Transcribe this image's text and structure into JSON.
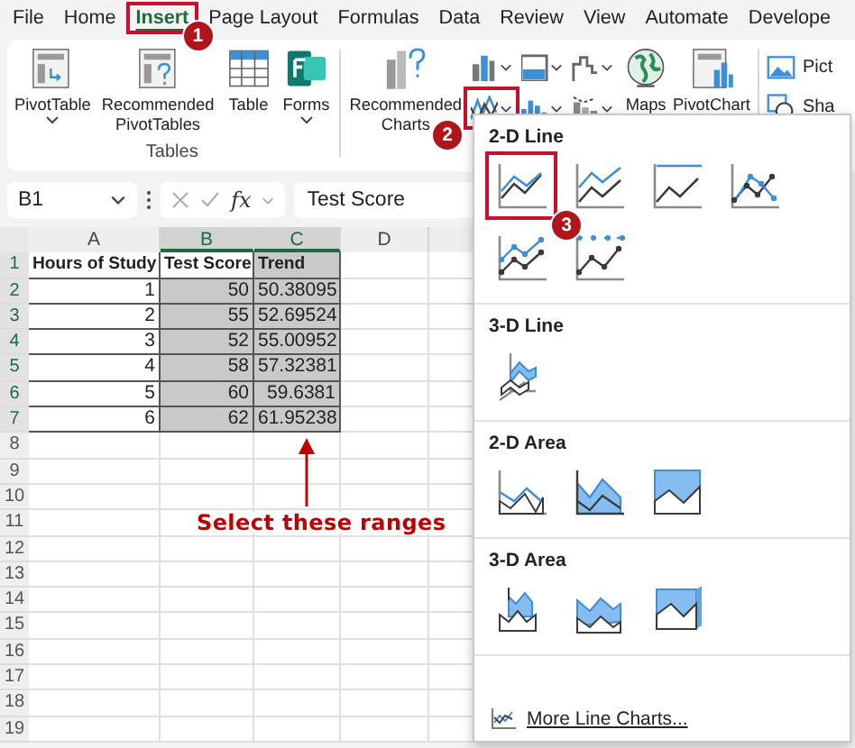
{
  "menu_tabs": [
    {
      "label": "File",
      "selected": false
    },
    {
      "label": "Home",
      "selected": false
    },
    {
      "label": "Insert",
      "selected": true,
      "callout": "1"
    },
    {
      "label": "Page Layout",
      "selected": false
    },
    {
      "label": "Formulas",
      "selected": false
    },
    {
      "label": "Data",
      "selected": false
    },
    {
      "label": "Review",
      "selected": false
    },
    {
      "label": "View",
      "selected": false
    },
    {
      "label": "Automate",
      "selected": false
    },
    {
      "label": "Develope",
      "selected": false
    }
  ],
  "tables_group": {
    "label": "Tables",
    "buttons": [
      {
        "kind": "pivot",
        "lines": [
          "PivotTable"
        ],
        "dropdown": true
      },
      {
        "kind": "recommended_pivot",
        "lines": [
          "Recommended",
          "PivotTables"
        ],
        "dropdown": false
      },
      {
        "kind": "table",
        "lines": [
          "Table"
        ],
        "dropdown": false
      },
      {
        "kind": "forms",
        "lines": [
          "Forms"
        ],
        "dropdown": true
      }
    ]
  },
  "charts_group": {
    "recommended": {
      "kind": "recommended_charts",
      "lines": [
        "Recommended",
        "Charts"
      ]
    },
    "chart_buttons": [
      {
        "kind": "column"
      },
      {
        "kind": "hierarchy"
      },
      {
        "kind": "waterfall"
      },
      {
        "kind": "line",
        "callout": "2"
      },
      {
        "kind": "statistic"
      },
      {
        "kind": "scatter"
      }
    ],
    "big_buttons": [
      {
        "kind": "maps",
        "label": "Maps"
      },
      {
        "kind": "pivot_chart",
        "label": "PivotChart"
      }
    ]
  },
  "illustrations_partial": [
    {
      "kind": "picture",
      "label": "Pict"
    },
    {
      "kind": "shapes",
      "label": "Sha"
    }
  ],
  "formula_bar": {
    "name_box": "B1",
    "function_label": "fx",
    "value": "Test Score"
  },
  "sheet": {
    "columns": [
      {
        "label": "A",
        "selected": false
      },
      {
        "label": "B",
        "selected": true
      },
      {
        "label": "C",
        "selected": true
      },
      {
        "label": "D",
        "selected": false
      }
    ],
    "rows": [
      {
        "number": "1",
        "cells": [
          {
            "text": "Hours of Study",
            "selected": false
          },
          {
            "text": "Test Score",
            "selected": false
          },
          {
            "text": "Trend",
            "selected": true
          }
        ]
      },
      {
        "number": "2",
        "cells": [
          {
            "text": "1",
            "selected": false
          },
          {
            "text": "50",
            "selected": true
          },
          {
            "text": "50.38095",
            "selected": true
          }
        ]
      },
      {
        "number": "3",
        "cells": [
          {
            "text": "2",
            "selected": false
          },
          {
            "text": "55",
            "selected": true
          },
          {
            "text": "52.69524",
            "selected": true
          }
        ]
      },
      {
        "number": "4",
        "cells": [
          {
            "text": "3",
            "selected": false
          },
          {
            "text": "52",
            "selected": true
          },
          {
            "text": "55.00952",
            "selected": true
          }
        ]
      },
      {
        "number": "5",
        "cells": [
          {
            "text": "4",
            "selected": false
          },
          {
            "text": "58",
            "selected": true
          },
          {
            "text": "57.32381",
            "selected": true
          }
        ]
      },
      {
        "number": "6",
        "cells": [
          {
            "text": "5",
            "selected": false
          },
          {
            "text": "60",
            "selected": true
          },
          {
            "text": "59.6381",
            "selected": true
          }
        ]
      },
      {
        "number": "7",
        "cells": [
          {
            "text": "6",
            "selected": false
          },
          {
            "text": "62",
            "selected": true
          },
          {
            "text": "61.95238",
            "selected": true
          }
        ]
      }
    ],
    "empty_rows": [
      "8",
      "9",
      "10",
      "11",
      "12",
      "13",
      "14",
      "15",
      "16",
      "17",
      "18",
      "19"
    ]
  },
  "note": "Select these ranges",
  "chart_menu": {
    "sections": [
      {
        "title": "2-D Line",
        "options": [
          {
            "kind": "line",
            "selected": true,
            "callout": "3"
          },
          {
            "kind": "stacked_line",
            "selected": false
          },
          {
            "kind": "stacked100_line",
            "selected": false
          },
          {
            "kind": "line_markers",
            "selected": false
          },
          {
            "kind": "stacked_line_markers",
            "selected": false
          },
          {
            "kind": "stacked100_line_markers",
            "selected": false
          }
        ]
      },
      {
        "title": "3-D Line",
        "options": [
          {
            "kind": "line_3d",
            "selected": false
          }
        ]
      },
      {
        "title": "2-D Area",
        "options": [
          {
            "kind": "area",
            "selected": false
          },
          {
            "kind": "stacked_area",
            "selected": false
          },
          {
            "kind": "stacked100_area",
            "selected": false
          }
        ]
      },
      {
        "title": "3-D Area",
        "options": [
          {
            "kind": "area_3d",
            "selected": false
          },
          {
            "kind": "stacked_area_3d",
            "selected": false
          },
          {
            "kind": "stacked100_area_3d",
            "selected": false
          }
        ]
      }
    ],
    "more_link": "More Line Charts..."
  }
}
